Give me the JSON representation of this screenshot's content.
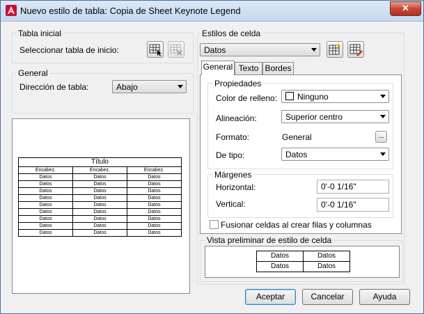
{
  "window": {
    "title": "Nuevo estilo de tabla: Copia de Sheet Keynote Legend",
    "close_glyph": "✕"
  },
  "left": {
    "tabla_inicial": {
      "heading": "Tabla inicial",
      "select_label": "Seleccionar tabla de inicio:"
    },
    "general": {
      "heading": "General",
      "direction_label": "Dirección de tabla:",
      "direction_value": "Abajo"
    },
    "preview_table": {
      "title": "Título",
      "header": [
        "Encabez.",
        "Encabez.",
        "Encabez."
      ],
      "rows": [
        [
          "Datos",
          "Datos",
          "Datos"
        ],
        [
          "Datos",
          "Datos",
          "Datos"
        ],
        [
          "Datos",
          "Datos",
          "Datos"
        ],
        [
          "Datos",
          "Datos",
          "Datos"
        ],
        [
          "Datos",
          "Datos",
          "Datos"
        ],
        [
          "Datos",
          "Datos",
          "Datos"
        ],
        [
          "Datos",
          "Datos",
          "Datos"
        ],
        [
          "Datos",
          "Datos",
          "Datos"
        ],
        [
          "Datos",
          "Datos",
          "Datos"
        ]
      ]
    }
  },
  "right": {
    "cell_styles": {
      "heading": "Estilos de celda",
      "value": "Datos"
    },
    "tabs": [
      "General",
      "Texto",
      "Bordes"
    ],
    "propiedades": {
      "heading": "Propiedades",
      "fill_label": "Color de relleno:",
      "fill_value": "Ninguno",
      "align_label": "Alineación:",
      "align_value": "Superior centro",
      "format_label": "Formato:",
      "format_value": "General",
      "format_button": "...",
      "type_label": "De tipo:",
      "type_value": "Datos"
    },
    "margenes": {
      "heading": "Márgenes",
      "horizontal_label": "Horizontal:",
      "horizontal_value": "0'-0 1/16\"",
      "vertical_label": "Vertical:",
      "vertical_value": "0'-0 1/16\""
    },
    "merge_label": "Fusionar celdas al crear filas y columnas",
    "cell_preview": {
      "heading": "Vista preliminar de estilo de celda",
      "cells": [
        [
          "Datos",
          "Datos"
        ],
        [
          "Datos",
          "Datos"
        ]
      ]
    }
  },
  "buttons": {
    "ok": "Aceptar",
    "cancel": "Cancelar",
    "help": "Ayuda"
  },
  "icons": [
    "autocad-app-icon",
    "select-table-icon",
    "remove-table-icon",
    "new-cell-style-icon",
    "manage-cell-styles-icon"
  ]
}
